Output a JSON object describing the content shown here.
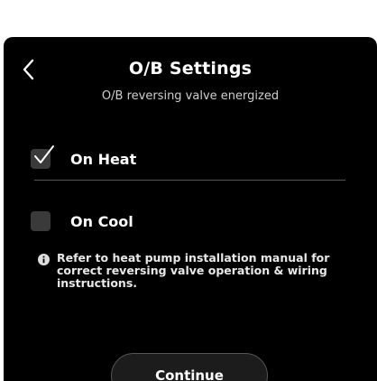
{
  "header": {
    "title": "O/B Settings",
    "subtitle": "O/B reversing valve energized",
    "back_icon": "chevron-left-icon"
  },
  "options": [
    {
      "label": "On Heat",
      "checked": true
    },
    {
      "label": "On Cool",
      "checked": false
    }
  ],
  "note": {
    "icon": "info-icon",
    "text": "Refer to heat pump installation manual for correct reversing valve operation & wiring instructions."
  },
  "actions": {
    "continue_label": "Continue"
  },
  "colors": {
    "background": "#000000",
    "text": "#ffffff",
    "checkbox_fill": "#3a3a3a",
    "divider": "#555555"
  }
}
